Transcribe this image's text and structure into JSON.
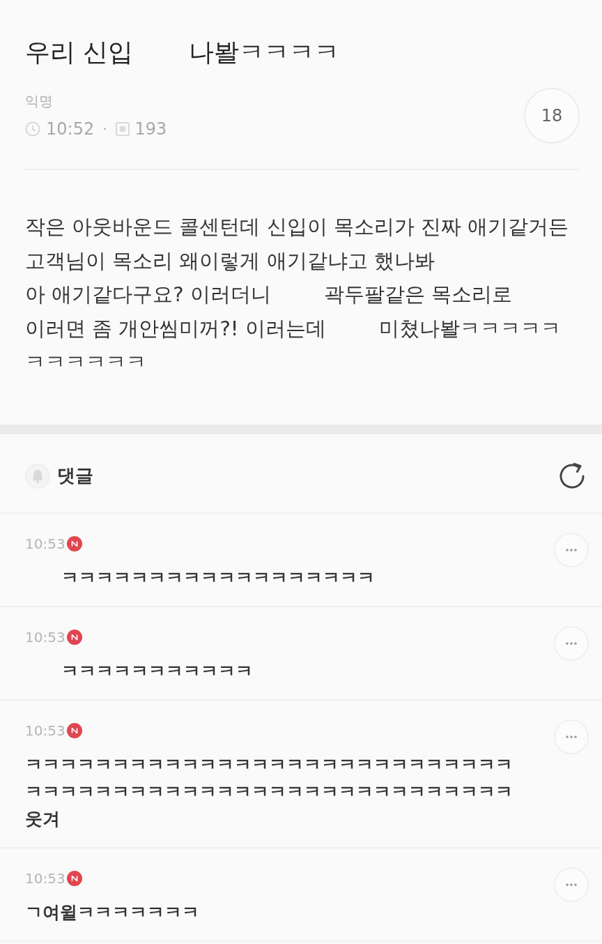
{
  "post": {
    "title": [
      "우리 신입",
      "나봘ㅋㅋㅋㅋ"
    ],
    "author": "익명",
    "time": "10:52",
    "separator": "·",
    "views": "193",
    "count": "18",
    "body": [
      [
        "작은 아웃바운드 콜센턴데 신입이 목소리가 진짜 애기같거든"
      ],
      [
        "고객님이 목소리 왜이렇게 애기같냐고 했나봐"
      ],
      [
        "아 애기같다구요? 이러더니",
        "곽두팔같은 목소리로"
      ],
      [
        "이러면 좀 개안씸미꺼?! 이러는데",
        "미쳤나봘ㅋㅋㅋㅋㅋ"
      ],
      [
        "ㅋㅋㅋㅋㅋㅋ"
      ]
    ]
  },
  "comments_header": {
    "label": "댓글"
  },
  "comments": [
    {
      "time": "10:53",
      "new": true,
      "redacted": true,
      "lines": [
        "ㅋㅋㅋㅋㅋㅋㅋㅋㅋㅋㅋㅋㅋㅋㅋㅋㅋㅋ"
      ]
    },
    {
      "time": "10:53",
      "new": true,
      "redacted": true,
      "lines": [
        "ㅋㅋㅋㅋㅋㅋㅋㅋㅋㅋㅋ"
      ]
    },
    {
      "time": "10:53",
      "new": true,
      "redacted": false,
      "lines": [
        "ㅋㅋㅋㅋㅋㅋㅋㅋㅋㅋㅋㅋㅋㅋㅋㅋㅋㅋㅋㅋㅋㅋㅋㅋㅋㅋㅋㅋ",
        "ㅋㅋㅋㅋㅋㅋㅋㅋㅋㅋㅋㅋㅋㅋㅋㅋㅋㅋㅋㅋㅋㅋㅋㅋㅋㅋㅋㅋ",
        "웃겨"
      ]
    },
    {
      "time": "10:53",
      "new": true,
      "redacted": false,
      "lines": [
        "ㄱ여윌ㅋㅋㅋㅋㅋㅋㅋ"
      ]
    }
  ]
}
